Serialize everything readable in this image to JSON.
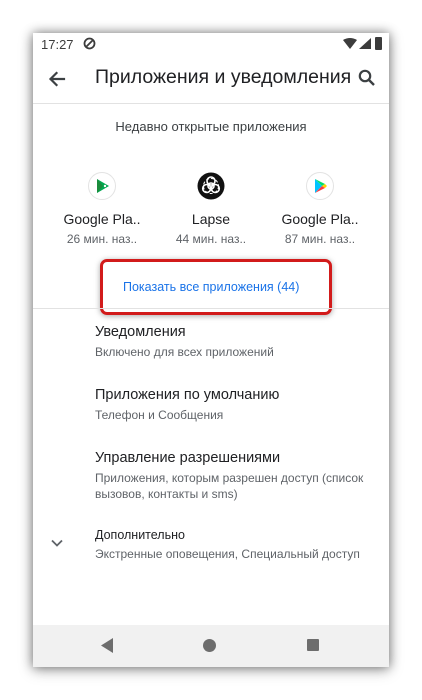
{
  "status_bar": {
    "time": "17:27"
  },
  "app_bar": {
    "title": "Приложения и уведомления"
  },
  "recent": {
    "title": "Недавно открытые приложения",
    "apps": [
      {
        "name": "Google Pla..",
        "time": "26 мин. наз.."
      },
      {
        "name": "Lapse",
        "time": "44 мин. наз.."
      },
      {
        "name": "Google Pla..",
        "time": "87 мин. наз.."
      }
    ],
    "show_all_label": "Показать все приложения (44)"
  },
  "prefs": [
    {
      "title": "Уведомления",
      "summary": "Включено для всех приложений"
    },
    {
      "title": "Приложения по умолчанию",
      "summary": "Телефон и Сообщения"
    },
    {
      "title": "Управление разрешениями",
      "summary": "Приложения, которым разрешен доступ (список вызовов, контакты и sms)"
    },
    {
      "title": "Дополнительно",
      "summary": "Экстренные оповещения, Специальный доступ"
    }
  ],
  "colors": {
    "accent": "#1a73e8",
    "highlight": "#d21b1b"
  }
}
